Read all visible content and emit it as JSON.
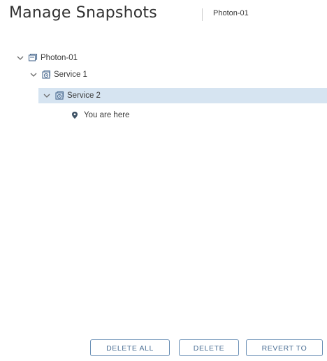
{
  "header": {
    "title": "Manage Snapshots",
    "vm_name": "Photon-01"
  },
  "tree": {
    "root": {
      "label": "Photon-01",
      "icon": "vm-icon",
      "expanded": true
    },
    "service1": {
      "label": "Service 1",
      "icon": "snapshot-icon",
      "expanded": true
    },
    "service2": {
      "label": "Service 2",
      "icon": "snapshot-icon",
      "expanded": true,
      "selected": true
    },
    "current": {
      "label": "You are here",
      "icon": "map-pin-icon"
    }
  },
  "actions": {
    "delete_all": "DELETE ALL",
    "delete": "DELETE",
    "revert_to": "REVERT TO"
  },
  "colors": {
    "selection_bg": "#d6e4f1",
    "button_border": "#6a8fb5",
    "button_text": "#4b6f95",
    "icon": "#4a6a8f"
  }
}
